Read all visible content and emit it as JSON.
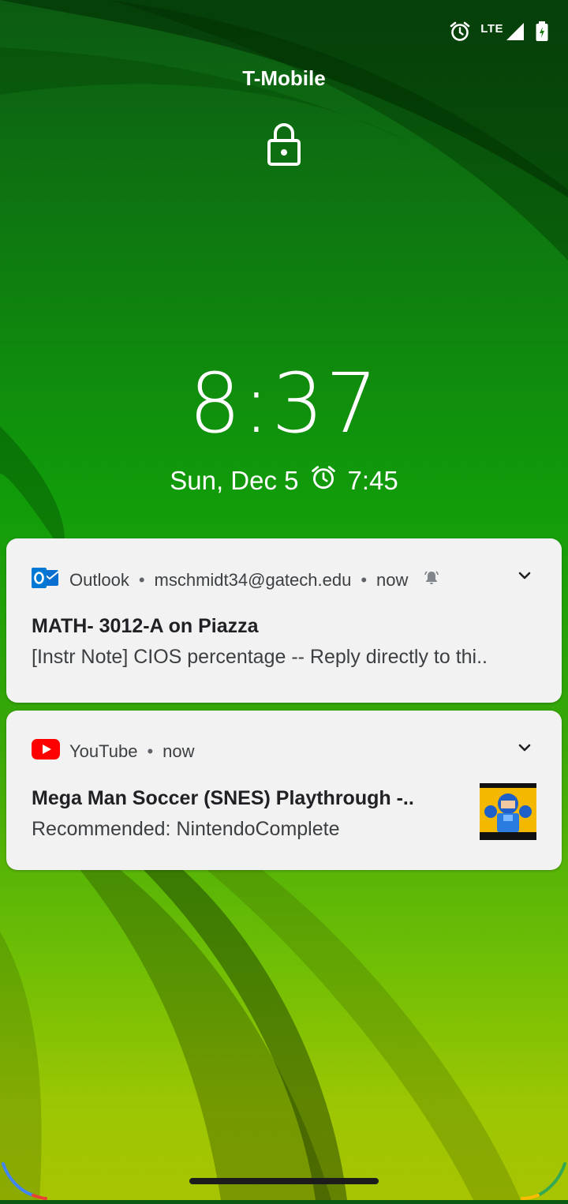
{
  "status": {
    "network": "LTE"
  },
  "carrier": "T-Mobile",
  "lockscreen": {
    "time": "8:37",
    "date": "Sun, Dec 5",
    "alarm_time": "7:45"
  },
  "notifications": [
    {
      "app": "Outlook",
      "account": "mschmidt34@gatech.edu",
      "when": "now",
      "title": "MATH- 3012-A on Piazza",
      "body": "[Instr Note] CIOS percentage -- Reply directly to thi..",
      "accent": "#0072c6"
    },
    {
      "app": "YouTube",
      "when": "now",
      "title": "Mega Man Soccer (SNES) Playthrough -..",
      "body": "Recommended: NintendoComplete",
      "accent": "#ff0000"
    }
  ]
}
